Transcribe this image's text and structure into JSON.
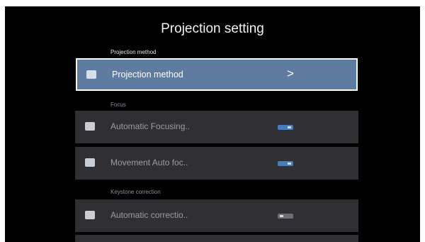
{
  "title": "Projection setting",
  "sections": {
    "projection": {
      "label": "Projection method"
    },
    "focus": {
      "label": "Focus"
    },
    "keystone": {
      "label": "Keystone correction"
    }
  },
  "rows": {
    "projection_method": {
      "label": "Projection method",
      "icon": "projection-icon",
      "chevron": ">"
    },
    "automatic_focusing": {
      "label": "Automatic Focusing..",
      "icon": "focus-icon",
      "toggle": "on"
    },
    "movement_auto_focus": {
      "label": "Movement Auto foc..",
      "icon": "focus-icon",
      "toggle": "on"
    },
    "automatic_correction": {
      "label": "Automatic correctio..",
      "icon": "keystone-icon",
      "toggle": "off"
    }
  },
  "colors": {
    "background": "#000000",
    "row": "#303034",
    "selected_row": "#5e7ba0",
    "toggle_on": "#3f7fc0"
  }
}
